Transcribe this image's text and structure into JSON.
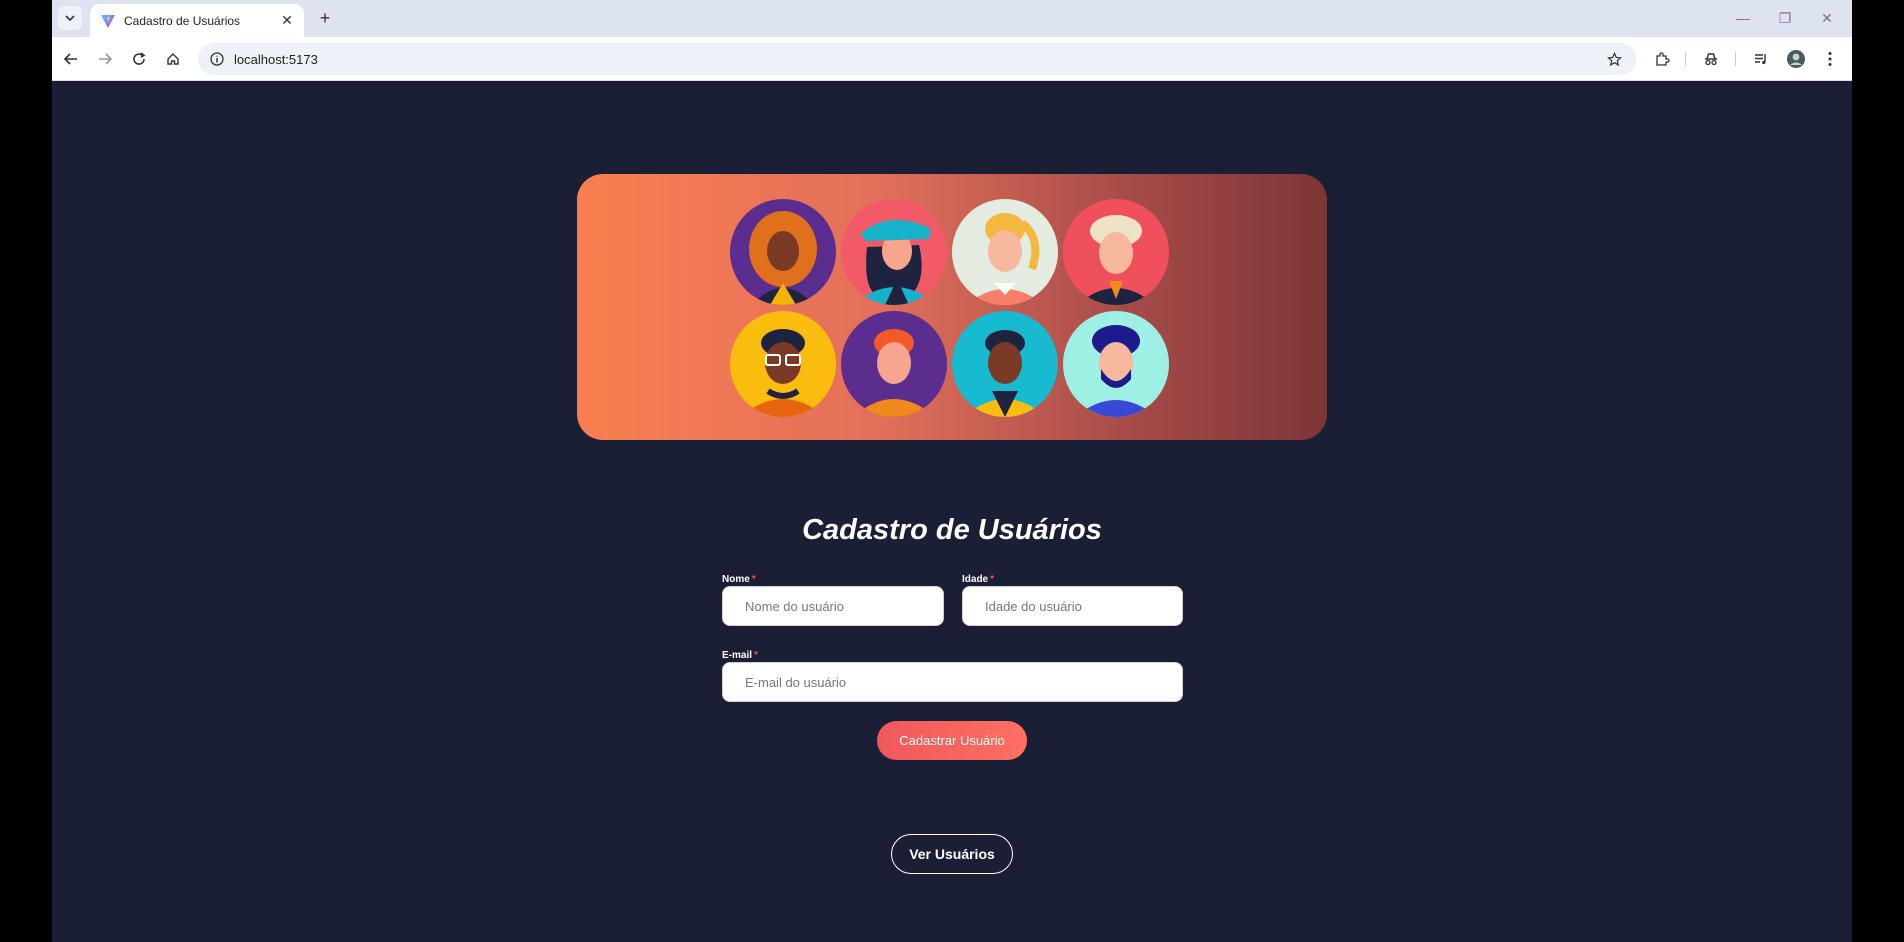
{
  "browser": {
    "tab_title": "Cadastro de Usuários",
    "url": "localhost:5173"
  },
  "page": {
    "title": "Cadastro de Usuários",
    "form": {
      "name_label": "Nome",
      "name_placeholder": "Nome do usuário",
      "age_label": "Idade",
      "age_placeholder": "Idade do usuário",
      "email_label": "E-mail",
      "email_placeholder": "E-mail do usuário",
      "required_mark": "*",
      "submit_label": "Cadastrar Usuário"
    },
    "view_users_label": "Ver Usuários"
  },
  "colors": {
    "background": "#1b1f36",
    "accent": "#f0585b",
    "banner_start": "#fa7f50",
    "banner_end": "#7d3536"
  },
  "banner": {
    "avatars": [
      {
        "name": "woman-curly-hair-avatar",
        "bg": "#5b2d8f"
      },
      {
        "name": "woman-cap-avatar",
        "bg": "#f25a67"
      },
      {
        "name": "woman-ponytail-avatar",
        "bg": "#e4ebe0"
      },
      {
        "name": "old-man-avatar",
        "bg": "#f0505c"
      },
      {
        "name": "man-glasses-avatar",
        "bg": "#fbbd0d"
      },
      {
        "name": "boy-redhead-avatar",
        "bg": "#5b2d8f"
      },
      {
        "name": "man-jacket-avatar",
        "bg": "#18bad1"
      },
      {
        "name": "man-beard-avatar",
        "bg": "#9ff0e4"
      }
    ]
  }
}
